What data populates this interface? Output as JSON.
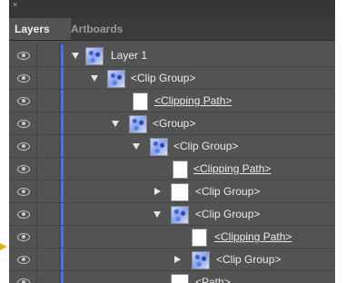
{
  "tabs": [
    "Layers",
    "Artboards"
  ],
  "close_glyph": "×",
  "indicator_color": "#f2a71b",
  "layer_color": "#4a6cf0",
  "rows": [
    {
      "label": "Layer 1",
      "expander": "down",
      "thumb": "art",
      "underline": false
    },
    {
      "label": "<Clip Group>",
      "expander": "down",
      "thumb": "art",
      "underline": false
    },
    {
      "label": "<Clipping Path>",
      "expander": "none",
      "thumb": "white",
      "underline": true
    },
    {
      "label": "<Group>",
      "expander": "down",
      "thumb": "art",
      "underline": false
    },
    {
      "label": "<Clip Group>",
      "expander": "down",
      "thumb": "art",
      "underline": false
    },
    {
      "label": "<Clipping Path>",
      "expander": "none",
      "thumb": "white",
      "underline": true
    },
    {
      "label": "<Clip Group>",
      "expander": "right",
      "thumb": "white",
      "underline": false
    },
    {
      "label": "<Clip Group>",
      "expander": "down",
      "thumb": "art",
      "underline": false
    },
    {
      "label": "<Clipping Path>",
      "expander": "none",
      "thumb": "white",
      "underline": true
    },
    {
      "label": "<Clip Group>",
      "expander": "right",
      "thumb": "art",
      "underline": false
    },
    {
      "label": "<Path>",
      "expander": "none",
      "thumb": "white",
      "underline": false
    }
  ]
}
